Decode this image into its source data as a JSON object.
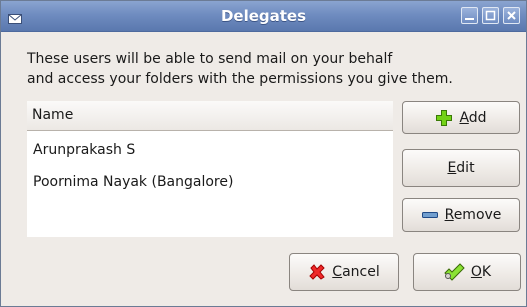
{
  "window": {
    "title": "Delegates",
    "icons": {
      "window_icon": "envelope-icon",
      "minimize": "minimize-icon",
      "maximize": "maximize-icon",
      "close": "close-icon"
    }
  },
  "description": {
    "line1": "These users will be able to send mail on your behalf",
    "line2": "and access your folders with the permissions you give them."
  },
  "list": {
    "column_header": "Name",
    "rows": [
      "Arunprakash S",
      "Poornima Nayak (Bangalore)"
    ]
  },
  "buttons": {
    "add": {
      "mnemonic": "A",
      "rest": "dd",
      "icon": "plus-icon"
    },
    "edit": {
      "mnemonic": "E",
      "rest": "dit"
    },
    "remove": {
      "mnemonic": "R",
      "rest": "emove",
      "icon": "minus-icon"
    },
    "cancel": {
      "mnemonic": "C",
      "rest": "ancel",
      "icon": "cancel-x-icon"
    },
    "ok": {
      "mnemonic": "O",
      "rest": "K",
      "icon": "ok-check-icon"
    }
  },
  "colors": {
    "titlebar": "#6f8cc0",
    "window_bg": "#efebe7",
    "add_icon": "#4e9a06",
    "remove_icon": "#3465a4",
    "cancel_icon": "#cc0000"
  }
}
